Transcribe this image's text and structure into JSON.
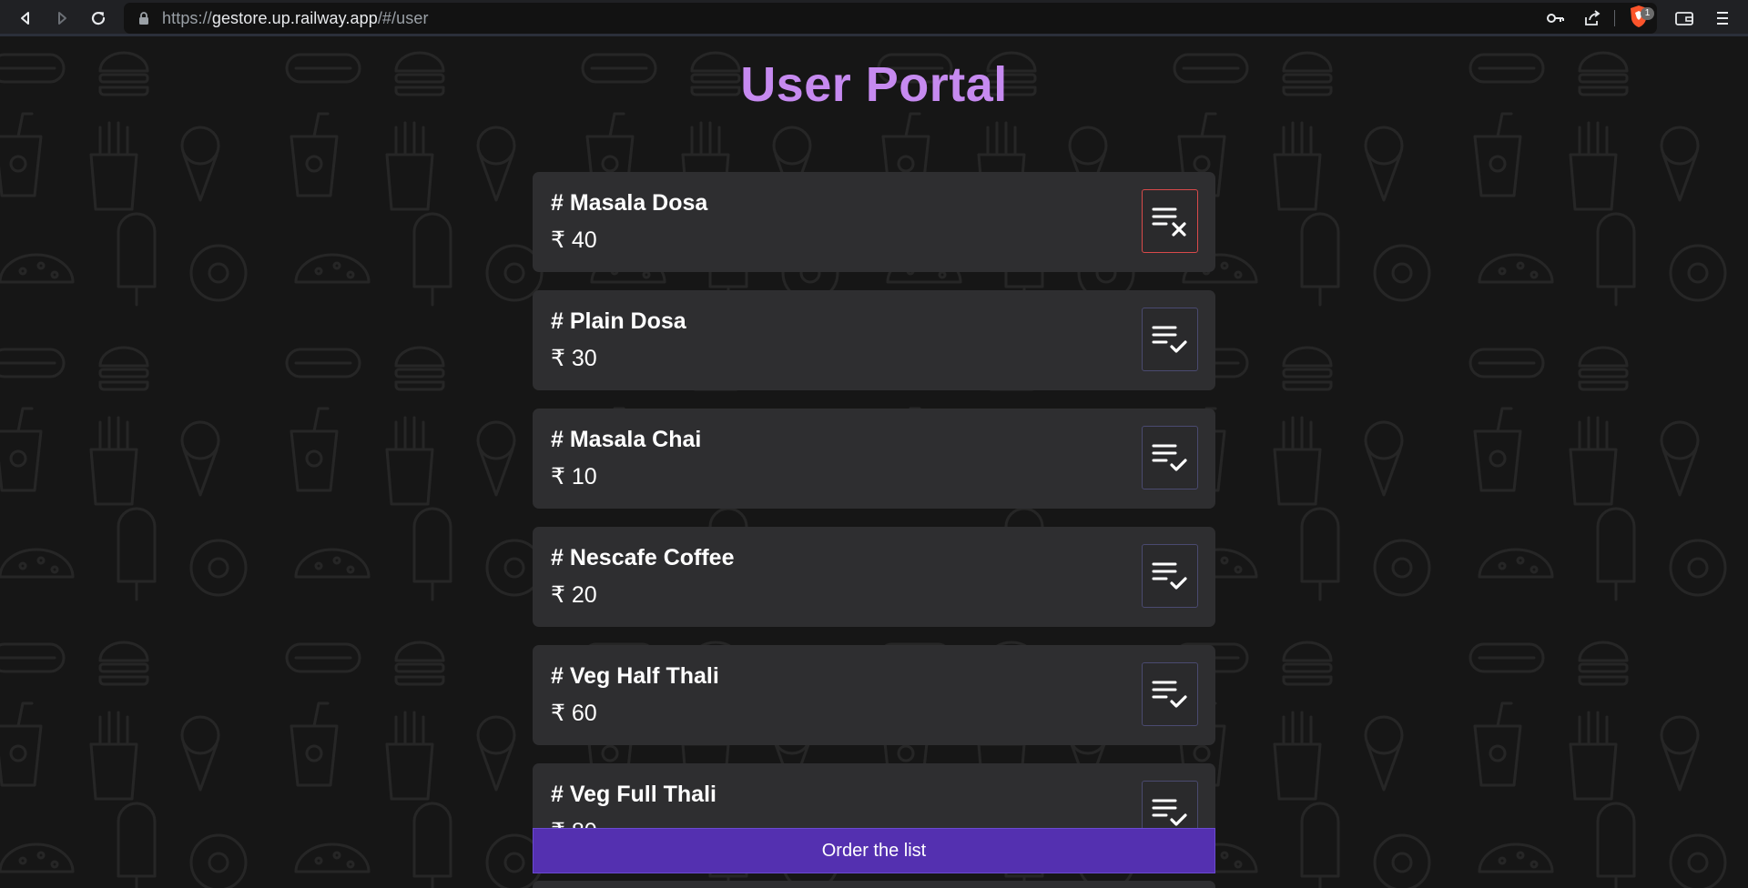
{
  "browser": {
    "url_scheme": "https://",
    "url_host": "gestore.up.railway.app",
    "url_path": "/#/user",
    "shields_count": "1"
  },
  "page": {
    "title": "User Portal",
    "currency_symbol": "₹",
    "items": [
      {
        "name": "# Masala Dosa",
        "price": "₹ 40",
        "action": "remove",
        "icon": "list-remove-icon"
      },
      {
        "name": "# Plain Dosa",
        "price": "₹ 30",
        "action": "add",
        "icon": "list-check-icon"
      },
      {
        "name": "# Masala Chai",
        "price": "₹ 10",
        "action": "add",
        "icon": "list-check-icon"
      },
      {
        "name": "# Nescafe Coffee",
        "price": "₹ 20",
        "action": "add",
        "icon": "list-check-icon"
      },
      {
        "name": "# Veg Half Thali",
        "price": "₹ 60",
        "action": "add",
        "icon": "list-check-icon"
      },
      {
        "name": "# Veg Full Thali",
        "price": "₹ 80",
        "action": "add",
        "icon": "list-check-icon"
      }
    ],
    "order_button_label": "Order the list"
  },
  "colors": {
    "title": "#c68af0",
    "order_button": "#5430b0",
    "remove_border": "#d94a4a",
    "add_border": "#4a4a70",
    "card_bg": "#2e2e30",
    "page_bg": "#161616"
  }
}
